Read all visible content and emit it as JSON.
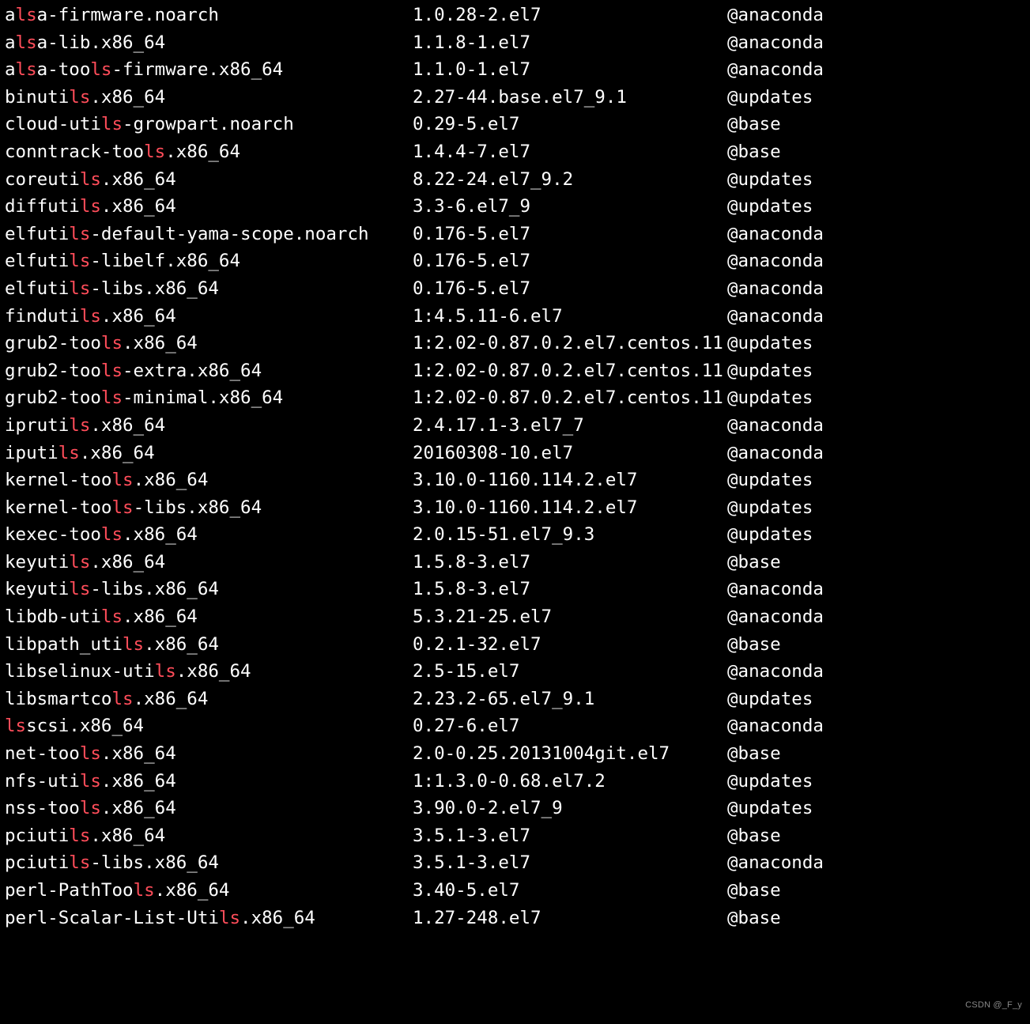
{
  "highlight": "ls",
  "watermark": "CSDN @_F_y",
  "packages": [
    {
      "name": "alsa-firmware.noarch",
      "version": "1.0.28-2.el7",
      "repo": "@anaconda"
    },
    {
      "name": "alsa-lib.x86_64",
      "version": "1.1.8-1.el7",
      "repo": "@anaconda"
    },
    {
      "name": "alsa-tools-firmware.x86_64",
      "version": "1.1.0-1.el7",
      "repo": "@anaconda"
    },
    {
      "name": "binutils.x86_64",
      "version": "2.27-44.base.el7_9.1",
      "repo": "@updates"
    },
    {
      "name": "cloud-utils-growpart.noarch",
      "version": "0.29-5.el7",
      "repo": "@base"
    },
    {
      "name": "conntrack-tools.x86_64",
      "version": "1.4.4-7.el7",
      "repo": "@base"
    },
    {
      "name": "coreutils.x86_64",
      "version": "8.22-24.el7_9.2",
      "repo": "@updates"
    },
    {
      "name": "diffutils.x86_64",
      "version": "3.3-6.el7_9",
      "repo": "@updates"
    },
    {
      "name": "elfutils-default-yama-scope.noarch",
      "version": "0.176-5.el7",
      "repo": "@anaconda"
    },
    {
      "name": "elfutils-libelf.x86_64",
      "version": "0.176-5.el7",
      "repo": "@anaconda"
    },
    {
      "name": "elfutils-libs.x86_64",
      "version": "0.176-5.el7",
      "repo": "@anaconda"
    },
    {
      "name": "findutils.x86_64",
      "version": "1:4.5.11-6.el7",
      "repo": "@anaconda"
    },
    {
      "name": "grub2-tools.x86_64",
      "version": "1:2.02-0.87.0.2.el7.centos.11",
      "repo": "@updates"
    },
    {
      "name": "grub2-tools-extra.x86_64",
      "version": "1:2.02-0.87.0.2.el7.centos.11",
      "repo": "@updates"
    },
    {
      "name": "grub2-tools-minimal.x86_64",
      "version": "1:2.02-0.87.0.2.el7.centos.11",
      "repo": "@updates"
    },
    {
      "name": "iprutils.x86_64",
      "version": "2.4.17.1-3.el7_7",
      "repo": "@anaconda"
    },
    {
      "name": "iputils.x86_64",
      "version": "20160308-10.el7",
      "repo": "@anaconda"
    },
    {
      "name": "kernel-tools.x86_64",
      "version": "3.10.0-1160.114.2.el7",
      "repo": "@updates"
    },
    {
      "name": "kernel-tools-libs.x86_64",
      "version": "3.10.0-1160.114.2.el7",
      "repo": "@updates"
    },
    {
      "name": "kexec-tools.x86_64",
      "version": "2.0.15-51.el7_9.3",
      "repo": "@updates"
    },
    {
      "name": "keyutils.x86_64",
      "version": "1.5.8-3.el7",
      "repo": "@base"
    },
    {
      "name": "keyutils-libs.x86_64",
      "version": "1.5.8-3.el7",
      "repo": "@anaconda"
    },
    {
      "name": "libdb-utils.x86_64",
      "version": "5.3.21-25.el7",
      "repo": "@anaconda"
    },
    {
      "name": "libpath_utils.x86_64",
      "version": "0.2.1-32.el7",
      "repo": "@base"
    },
    {
      "name": "libselinux-utils.x86_64",
      "version": "2.5-15.el7",
      "repo": "@anaconda"
    },
    {
      "name": "libsmartcols.x86_64",
      "version": "2.23.2-65.el7_9.1",
      "repo": "@updates"
    },
    {
      "name": "lsscsi.x86_64",
      "version": "0.27-6.el7",
      "repo": "@anaconda"
    },
    {
      "name": "net-tools.x86_64",
      "version": "2.0-0.25.20131004git.el7",
      "repo": "@base"
    },
    {
      "name": "nfs-utils.x86_64",
      "version": "1:1.3.0-0.68.el7.2",
      "repo": "@updates"
    },
    {
      "name": "nss-tools.x86_64",
      "version": "3.90.0-2.el7_9",
      "repo": "@updates"
    },
    {
      "name": "pciutils.x86_64",
      "version": "3.5.1-3.el7",
      "repo": "@base"
    },
    {
      "name": "pciutils-libs.x86_64",
      "version": "3.5.1-3.el7",
      "repo": "@anaconda"
    },
    {
      "name": "perl-PathTools.x86_64",
      "version": "3.40-5.el7",
      "repo": "@base"
    },
    {
      "name": "perl-Scalar-List-Utils.x86_64",
      "version": "1.27-248.el7",
      "repo": "@base"
    }
  ]
}
